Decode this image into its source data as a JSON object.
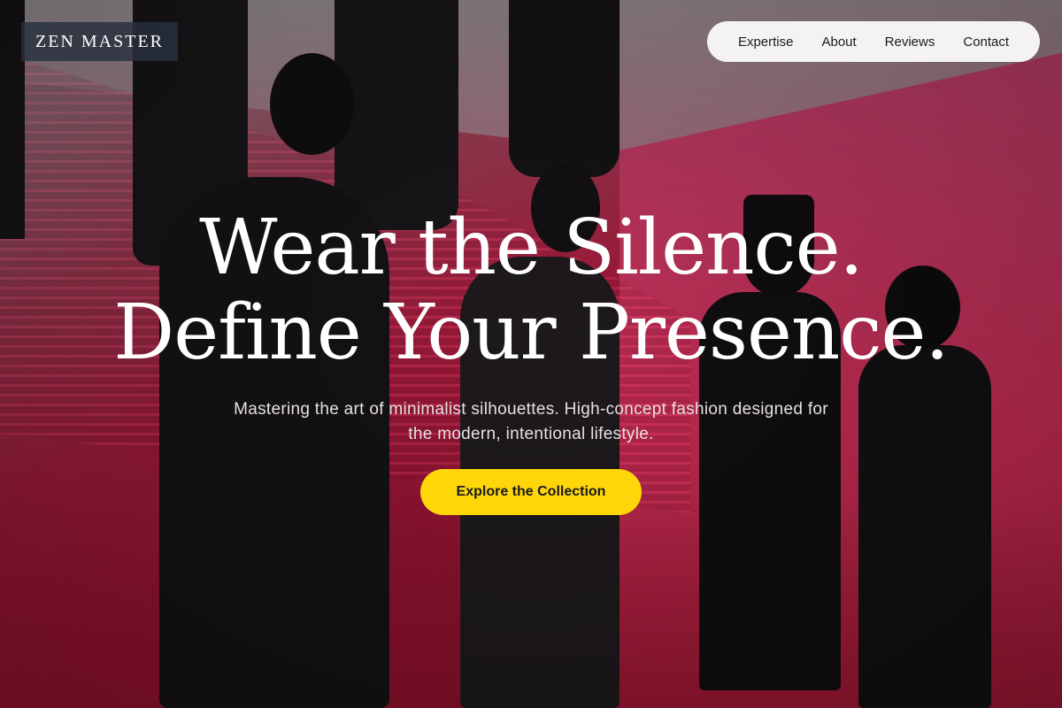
{
  "brand": {
    "logo_text": "ZEN MASTER"
  },
  "nav": {
    "items": [
      {
        "label": "Expertise"
      },
      {
        "label": "About"
      },
      {
        "label": "Reviews"
      },
      {
        "label": "Contact"
      }
    ]
  },
  "hero": {
    "headline_line1": "Wear the Silence.",
    "headline_line2": "Define Your Presence.",
    "subtitle": "Mastering the art of minimalist silhouettes. High-concept fashion designed for the modern, intentional lifestyle.",
    "cta_label": "Explore the Collection",
    "background_image": "mannequins-in-black-garments-against-magenta-wall"
  },
  "colors": {
    "accent": "#ffd60a",
    "nav_bg": "#f4f2f3",
    "logo_bg": "#28303e",
    "headline": "#ffffff",
    "background_dominant": "#c1214a"
  }
}
